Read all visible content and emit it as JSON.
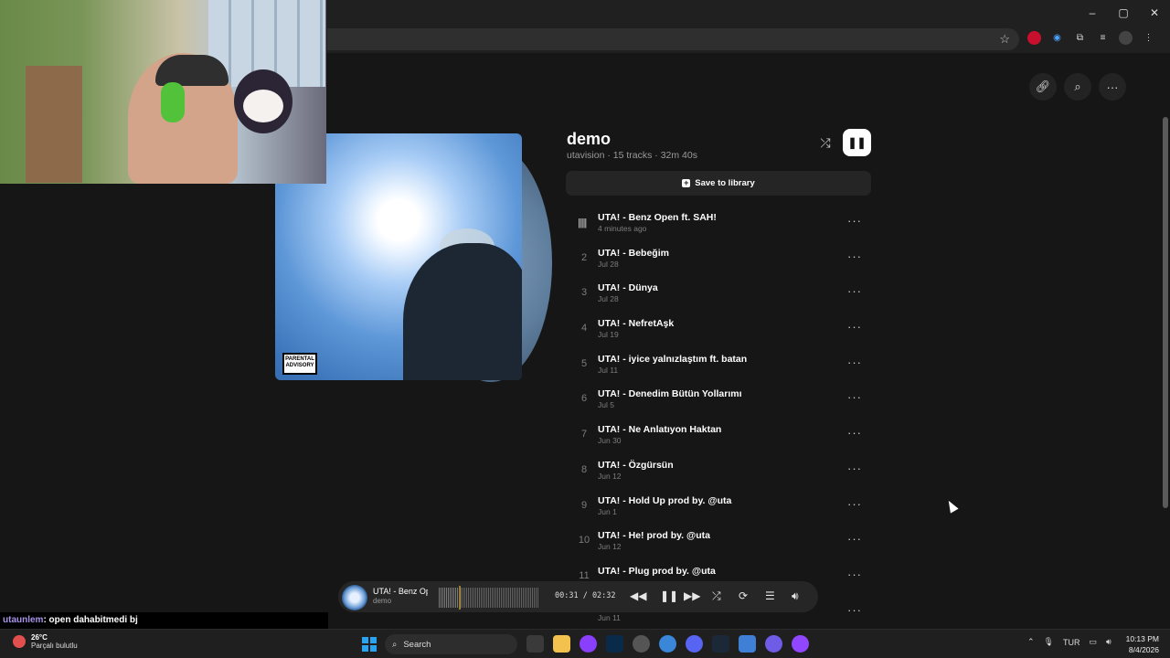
{
  "browser": {
    "window_controls": [
      "–",
      "▢",
      "✕"
    ],
    "star_icon": "star-icon"
  },
  "page_actions": [
    "link-icon",
    "search-icon",
    "more-icon"
  ],
  "playlist": {
    "title": "demo",
    "meta": "utavision · 15 tracks · 32m 40s",
    "save_label": "Save to library"
  },
  "tracks": [
    {
      "num": "",
      "title": "UTA! - Benz Open ft. SAH!",
      "date": "4 minutes ago",
      "playing": true
    },
    {
      "num": "2",
      "title": "UTA! - Bebeğim",
      "date": "Jul 28"
    },
    {
      "num": "3",
      "title": "UTA! - Dünya",
      "date": "Jul 28"
    },
    {
      "num": "4",
      "title": "UTA! - NefretAşk",
      "date": "Jul 19"
    },
    {
      "num": "5",
      "title": "UTA! - iyice yalnızlaştım ft. batan",
      "date": "Jul 11"
    },
    {
      "num": "6",
      "title": "UTA! - Denedim Bütün Yollarımı",
      "date": "Jul 5"
    },
    {
      "num": "7",
      "title": "UTA! - Ne Anlatıyon Haktan",
      "date": "Jun 30"
    },
    {
      "num": "8",
      "title": "UTA! - Özgürsün",
      "date": "Jun 12"
    },
    {
      "num": "9",
      "title": "UTA! - Hold Up prod by. @uta",
      "date": "Jun 1"
    },
    {
      "num": "10",
      "title": "UTA! - He! prod by. @uta",
      "date": "Jun 12"
    },
    {
      "num": "11",
      "title": "UTA! - Plug prod by. @uta",
      "date": ""
    },
    {
      "num": "",
      "title": "",
      "date": "Jun 11"
    }
  ],
  "player": {
    "title": "UTA! - Benz Op",
    "subtitle": "demo",
    "time": "00:31 / 02:32",
    "progress": 0.2
  },
  "advisory": "PARENTAL ADVISORY EXPLICIT CONTENT",
  "chat": {
    "user": "utaunlem",
    "message": ": open dahabitmedi bj"
  },
  "taskbar": {
    "temp": "26°C",
    "weather": "Parçalı bulutlu",
    "search_label": "Search",
    "lang": "TUR",
    "time": "10:13 PM",
    "date": "8/4/2026"
  },
  "colors": {
    "accent_playhead": "#f4c542",
    "chat_user": "#a993e9"
  }
}
